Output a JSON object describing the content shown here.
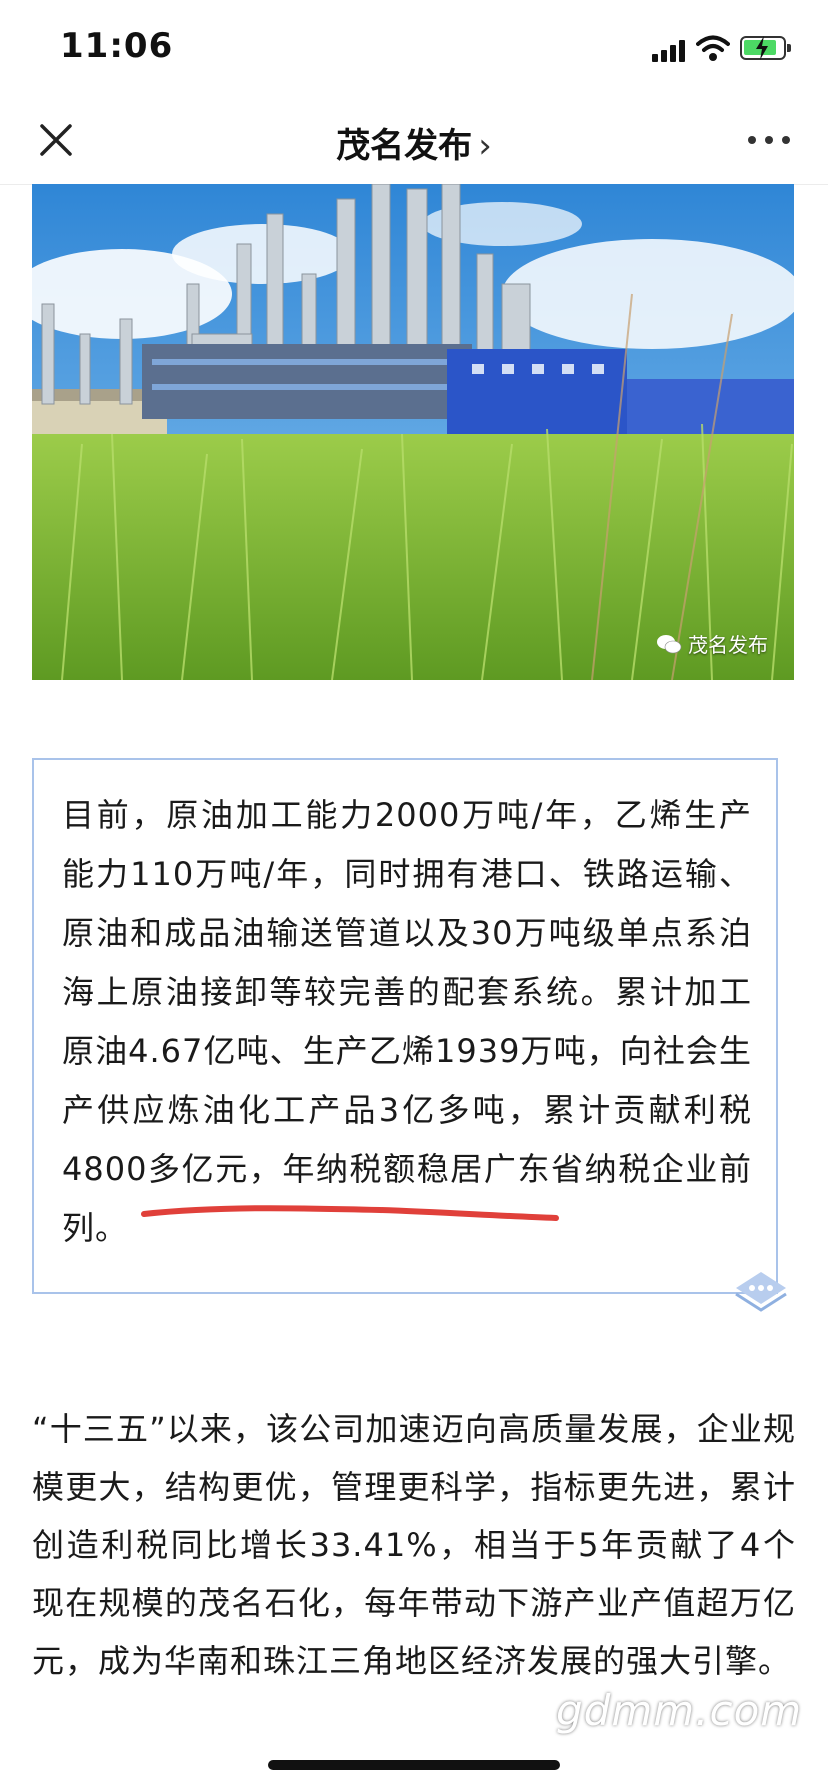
{
  "status_bar": {
    "time": "11:06"
  },
  "nav": {
    "title": "茂名发布",
    "chevron": "›"
  },
  "hero_image": {
    "watermark": "茂名发布",
    "description_icon": "wechat-icon"
  },
  "quote_box": {
    "text": "目前，原油加工能力2000万吨/年，乙烯生产能力110万吨/年，同时拥有港口、铁路运输、原油和成品油输送管道以及30万吨级单点系泊海上原油接卸等较完善的配套系统。累计加工原油4.67亿吨、生产乙烯1939万吨，向社会生产供应炼油化工产品3亿多吨，累计贡献利税4800多亿元，年纳税额稳居广东省纳税企业前列。"
  },
  "paragraph": {
    "text": "“十三五”以来，该公司加速迈向高质量发展，企业规模更大，结构更优，管理更科学，指标更先进，累计创造利税同比增长33.41%，相当于5年贡献了4个现在规模的茂名石化，每年带动下游产业产值超万亿元，成为华南和珠江三角地区经济发展的强大引擎。"
  },
  "site_watermark": "gdmm.com",
  "colors": {
    "accent_underline": "#e0403a",
    "box_border": "#a9c3ea",
    "battery_green": "#4cd964"
  }
}
